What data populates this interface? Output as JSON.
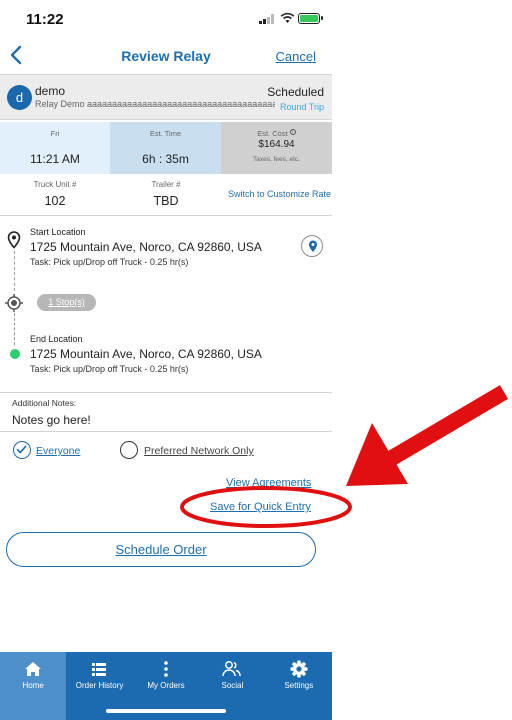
{
  "status_bar": {
    "time": "11:22"
  },
  "nav": {
    "title": "Review Relay",
    "cancel_label": "Cancel"
  },
  "customer": {
    "avatar_letter": "d",
    "name": "demo",
    "subtitle": "Relay Demo aaaaaaaaaaaaaaaaaaaaaaaaaaaaaaaaaaaaaaaa",
    "status": "Scheduled",
    "trip_type": "Round Trip"
  },
  "info": {
    "day_label": "Fri",
    "day_value": "11:21 AM",
    "time_label": "Est. Time",
    "time_value": "6h : 35m",
    "cost_label": "Est. Cost",
    "cost_value": "$164.94",
    "cost_note": "Taxes, fees, etc."
  },
  "truck": {
    "unit_label": "Truck Unit #",
    "unit_value": "102",
    "trailer_label": "Trailer #",
    "trailer_value": "TBD",
    "switch_label": "Switch to Customize Rate"
  },
  "route": {
    "start_label": "Start Location",
    "start_address": "1725 Mountain Ave, Norco, CA 92860, USA",
    "start_task": "Task: Pick up/Drop off Truck - 0.25 hr(s)",
    "stops_label": "1 Stop(s)",
    "end_label": "End Location",
    "end_address": "1725 Mountain Ave, Norco, CA 92860, USA",
    "end_task": "Task: Pick up/Drop off Truck - 0.25 hr(s)"
  },
  "notes": {
    "label": "Additional Notes:",
    "value": "Notes go here!"
  },
  "audience": {
    "everyone_label": "Everyone",
    "preferred_label": "Preferred Network Only",
    "selected": "Everyone"
  },
  "links": {
    "view_agreements": "View Agreements",
    "save_quick_entry": "Save for Quick Entry"
  },
  "schedule_button": "Schedule Order",
  "tabs": [
    {
      "label": "Home",
      "icon": "home-icon",
      "active": true
    },
    {
      "label": "Order History",
      "icon": "list-icon",
      "active": false
    },
    {
      "label": "My Orders",
      "icon": "more-vertical-icon",
      "active": false
    },
    {
      "label": "Social",
      "icon": "people-icon",
      "active": false
    },
    {
      "label": "Settings",
      "icon": "gear-icon",
      "active": false
    }
  ],
  "colors": {
    "brand_blue": "#1c6aaf",
    "link_blue": "#1f6fae",
    "annotation_red": "#e01010",
    "success_green": "#2ecc71"
  }
}
